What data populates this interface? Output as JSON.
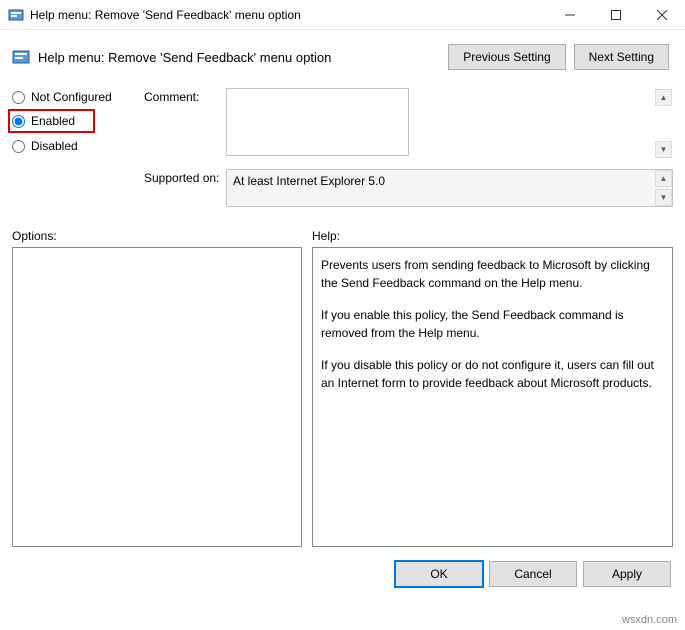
{
  "window": {
    "title": "Help menu: Remove 'Send Feedback' menu option"
  },
  "header": {
    "title": "Help menu: Remove 'Send Feedback' menu option",
    "prev": "Previous Setting",
    "next": "Next Setting"
  },
  "config": {
    "not_configured": "Not Configured",
    "enabled": "Enabled",
    "disabled": "Disabled",
    "comment_label": "Comment:",
    "comment_value": "",
    "supported_label": "Supported on:",
    "supported_value": "At least Internet Explorer 5.0"
  },
  "panels": {
    "options_label": "Options:",
    "help_label": "Help:",
    "help_p1": "Prevents users from sending feedback to Microsoft by clicking the Send Feedback command on the Help menu.",
    "help_p2": "If you enable this policy, the Send Feedback command is removed from the Help menu.",
    "help_p3": "If you disable this policy or do not configure it, users can fill out an Internet form to provide feedback about Microsoft products."
  },
  "footer": {
    "ok": "OK",
    "cancel": "Cancel",
    "apply": "Apply"
  },
  "watermark": "wsxdn.com"
}
